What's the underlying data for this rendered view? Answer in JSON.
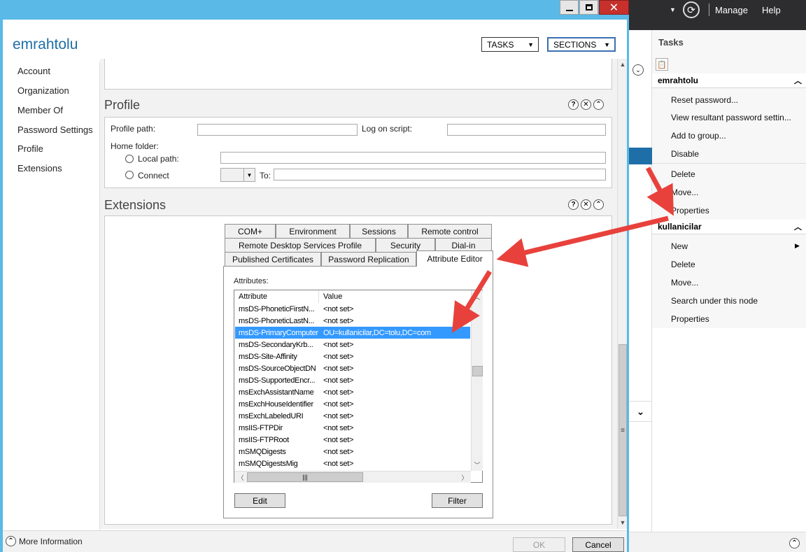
{
  "dialog": {
    "user_name": "emrahtolu",
    "tasks_label": "TASKS",
    "sections_label": "SECTIONS"
  },
  "nav": {
    "items": [
      "Account",
      "Organization",
      "Member Of",
      "Password Settings",
      "Profile",
      "Extensions"
    ]
  },
  "profile": {
    "title": "Profile",
    "profile_path_label": "Profile path:",
    "logon_script_label": "Log on script:",
    "home_folder_label": "Home folder:",
    "local_path_label": "Local path:",
    "connect_label": "Connect",
    "to_label": "To:"
  },
  "extensions": {
    "title": "Extensions",
    "tabs_row1": [
      "COM+",
      "Environment",
      "Sessions",
      "Remote control"
    ],
    "tabs_row2": [
      "Remote Desktop Services Profile",
      "Security",
      "Dial-in"
    ],
    "tabs_row3": [
      "Published Certificates",
      "Password Replication",
      "Attribute Editor"
    ],
    "attributes_label": "Attributes:",
    "col_attribute": "Attribute",
    "col_value": "Value",
    "rows": [
      {
        "attr": "msDS-PhoneticFirstN...",
        "value": "<not set>"
      },
      {
        "attr": "msDS-PhoneticLastN...",
        "value": "<not set>"
      },
      {
        "attr": "msDS-PrimaryComputer",
        "value": "OU=kullanicilar,DC=tolu,DC=com"
      },
      {
        "attr": "msDS-SecondaryKrb...",
        "value": "<not set>"
      },
      {
        "attr": "msDS-Site-Affinity",
        "value": "<not set>"
      },
      {
        "attr": "msDS-SourceObjectDN",
        "value": "<not set>"
      },
      {
        "attr": "msDS-SupportedEncr...",
        "value": "<not set>"
      },
      {
        "attr": "msExchAssistantName",
        "value": "<not set>"
      },
      {
        "attr": "msExchHouseIdentifier",
        "value": "<not set>"
      },
      {
        "attr": "msExchLabeledURI",
        "value": "<not set>"
      },
      {
        "attr": "msIIS-FTPDir",
        "value": "<not set>"
      },
      {
        "attr": "msIIS-FTPRoot",
        "value": "<not set>"
      },
      {
        "attr": "mSMQDigests",
        "value": "<not set>"
      },
      {
        "attr": "mSMQDigestsMig",
        "value": "<not set>"
      }
    ],
    "edit_label": "Edit",
    "filter_label": "Filter"
  },
  "bottom": {
    "more_info": "More Information",
    "ok_label": "OK",
    "cancel_label": "Cancel"
  },
  "server_manager": {
    "manage_label": "Manage",
    "help_label": "Help",
    "tasks_header": "Tasks",
    "group1_title": "emrahtolu",
    "group1_items": [
      "Reset password...",
      "View resultant password settin...",
      "Add to group...",
      "Disable",
      "Delete",
      "Move...",
      "Properties"
    ],
    "group2_title": "kullanicilar",
    "group2_items": [
      "New",
      "Delete",
      "Move...",
      "Search under this node",
      "Properties"
    ]
  },
  "colors": {
    "window_frame": "#5ab9e6",
    "selection": "#3399ff",
    "arrow": "#e8413c",
    "title_blue": "#1e6ea8"
  }
}
